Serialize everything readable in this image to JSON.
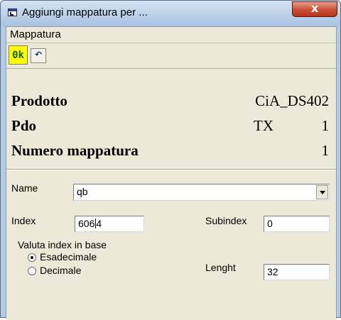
{
  "window": {
    "title": "Aggiungi mappatura per ...",
    "close_glyph": "x"
  },
  "menu": {
    "items": [
      "Mappatura"
    ]
  },
  "toolbar": {
    "ok_label": "0k",
    "ok_highlight_color": "#ffff00",
    "undo_icon": "undo-icon",
    "undo_glyph": "↶"
  },
  "info": {
    "prodotto_label": "Prodotto",
    "prodotto_value": "CiA_DS402",
    "pdo_label": "Pdo",
    "pdo_type": "TX",
    "pdo_number": "1",
    "numero_label": "Numero mappatura",
    "numero_value": "1"
  },
  "form": {
    "name_label": "Name",
    "name_value": "qb",
    "index_label": "Index",
    "index_value_before_caret": "606",
    "index_value_after_caret": "4",
    "subindex_label": "Subindex",
    "subindex_value": "0",
    "base_label": "Valuta index in base",
    "base_options": [
      "Esadecimale",
      "Decimale"
    ],
    "base_selected": "Esadecimale",
    "length_label": "Lenght",
    "length_value": "32"
  }
}
